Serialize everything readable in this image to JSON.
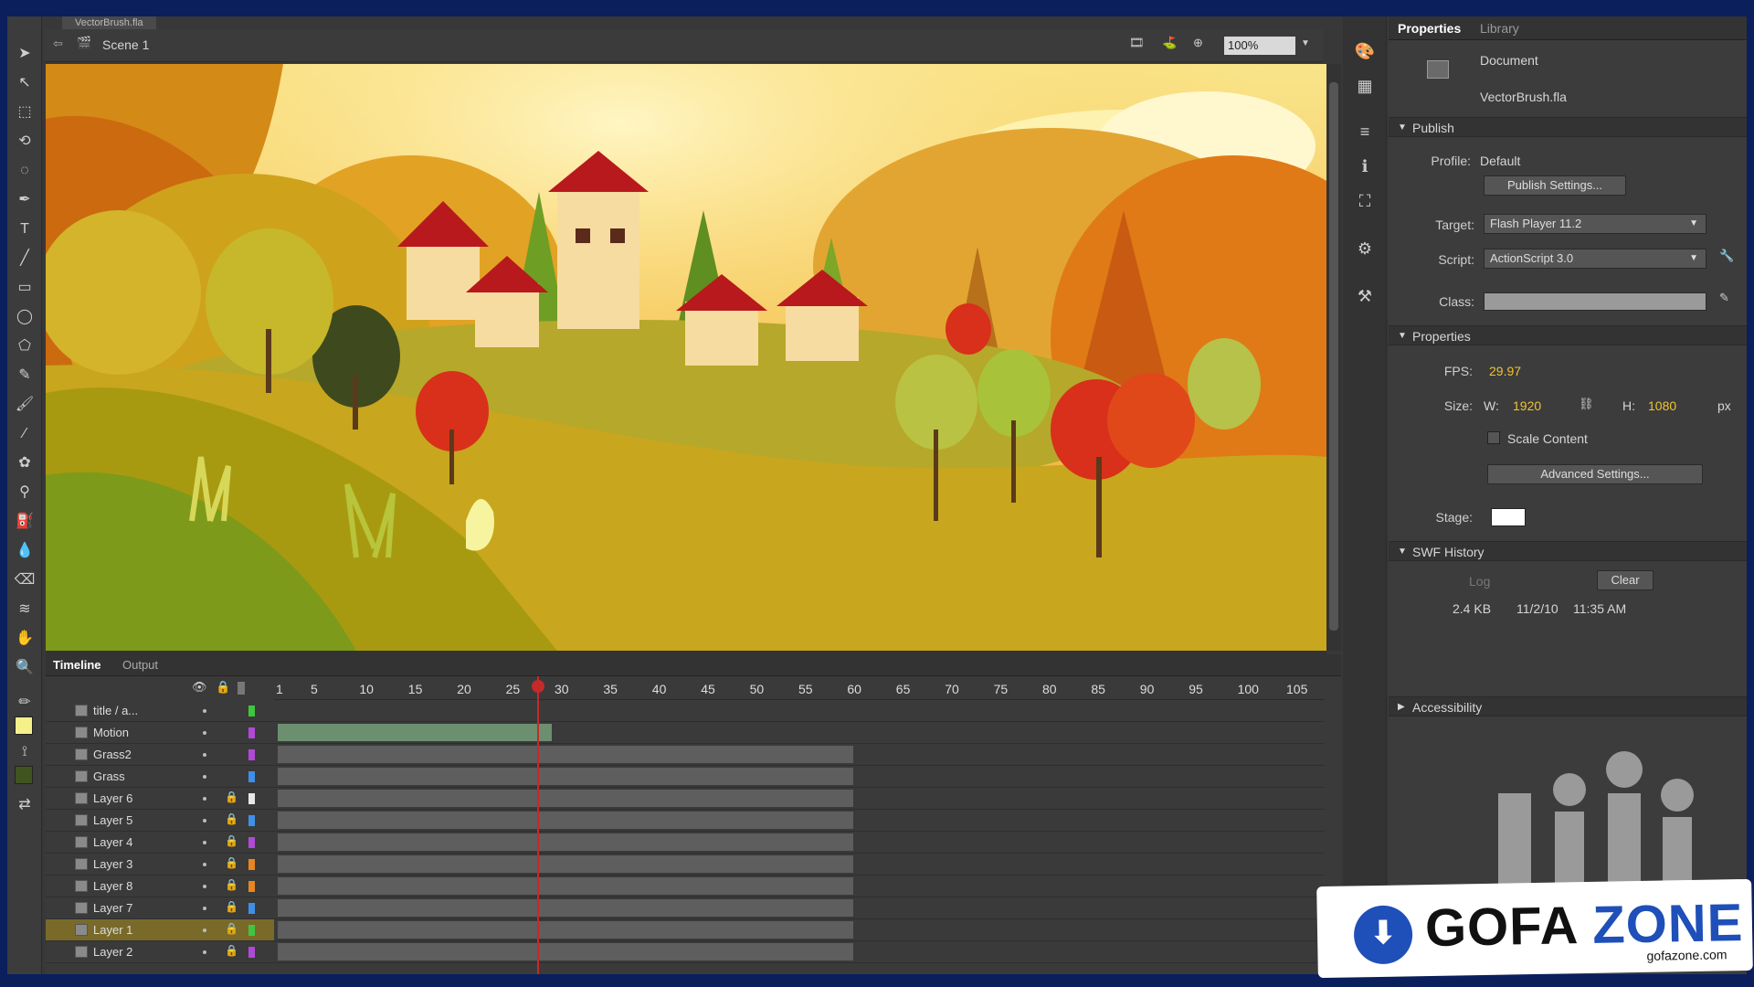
{
  "window": {
    "document_tab": "VectorBrush.fla",
    "scene_label": "Scene 1",
    "zoom": "100%"
  },
  "timeline": {
    "tabs": [
      "Timeline",
      "Output"
    ],
    "ruler": [
      "1",
      "5",
      "10",
      "15",
      "20",
      "25",
      "30",
      "35",
      "40",
      "45",
      "50",
      "55",
      "60",
      "65",
      "70",
      "75",
      "80",
      "85",
      "90",
      "95",
      "100",
      "105"
    ],
    "layers": [
      {
        "name": "title / a...",
        "color": "#3ec63e"
      },
      {
        "name": "Motion",
        "color": "#b04ad6"
      },
      {
        "name": "Grass2",
        "color": "#b04ad6"
      },
      {
        "name": "Grass",
        "color": "#3f8fe8"
      },
      {
        "name": "Layer 6",
        "color": "#e8e8e8"
      },
      {
        "name": "Layer 5",
        "color": "#3f8fe8"
      },
      {
        "name": "Layer 4",
        "color": "#b04ad6"
      },
      {
        "name": "Layer 3",
        "color": "#e8861f"
      },
      {
        "name": "Layer 8",
        "color": "#e8861f"
      },
      {
        "name": "Layer 7",
        "color": "#3f8fe8"
      },
      {
        "name": "Layer 1",
        "color": "#3ec63e"
      },
      {
        "name": "Layer 2",
        "color": "#b04ad6"
      }
    ]
  },
  "properties": {
    "tabs": [
      "Properties",
      "Library"
    ],
    "document_label": "Document",
    "document_name": "VectorBrush.fla",
    "publish": {
      "section": "Publish",
      "profile_label": "Profile:",
      "profile_value": "Default",
      "settings_button": "Publish Settings...",
      "target_label": "Target:",
      "target_value": "Flash Player 11.2",
      "script_label": "Script:",
      "script_value": "ActionScript 3.0",
      "class_label": "Class:"
    },
    "props": {
      "section": "Properties",
      "fps_label": "FPS:",
      "fps_value": "29.97",
      "size_label": "Size:",
      "w_label": "W:",
      "w_value": "1920",
      "h_label": "H:",
      "h_value": "1080",
      "unit": "px",
      "scale_label": "Scale Content",
      "advanced_button": "Advanced Settings...",
      "stage_label": "Stage:"
    },
    "swf": {
      "section": "SWF History",
      "log_button": "Log",
      "clear_button": "Clear",
      "size": "2.4 KB",
      "date": "11/2/10",
      "time": "11:35 AM"
    },
    "accessibility": "Accessibility"
  },
  "watermark": {
    "brand_a": "GOFA",
    "brand_b": "ZONE",
    "url": "gofazone.com"
  },
  "colors": {
    "accent": "#f0c330",
    "playhead": "#c52a2a",
    "watermark_blue": "#1f4fb8"
  }
}
